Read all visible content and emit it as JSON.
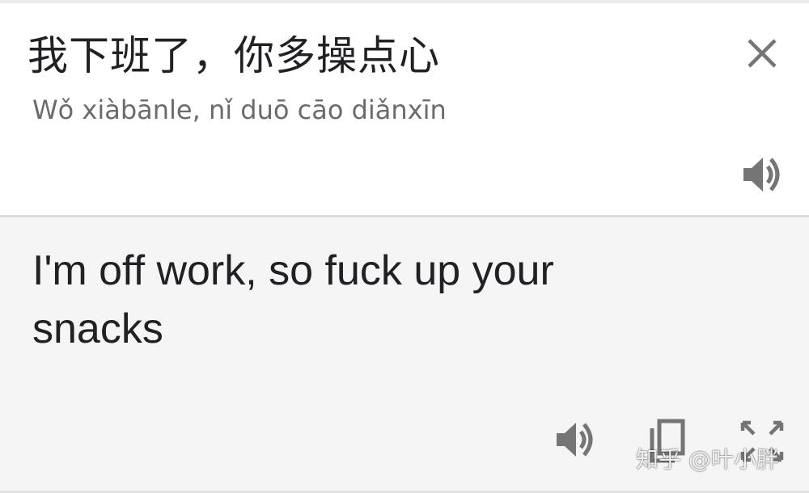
{
  "source": {
    "text": "我下班了，你多操点心",
    "pinyin": "Wǒ xiàbānle, nǐ duō cāo diǎnxīn"
  },
  "target": {
    "text": "I'm off work, so fuck up your snacks"
  },
  "icons": {
    "close": "close-icon",
    "speaker": "speaker-icon",
    "copy": "copy-icon",
    "expand": "fullscreen-icon"
  },
  "watermark": "知乎 @叶小胖",
  "colors": {
    "source_bg": "#ffffff",
    "target_bg": "#f5f5f5",
    "text": "#202124",
    "pinyin": "#6b6b6b",
    "icon": "#757575"
  }
}
